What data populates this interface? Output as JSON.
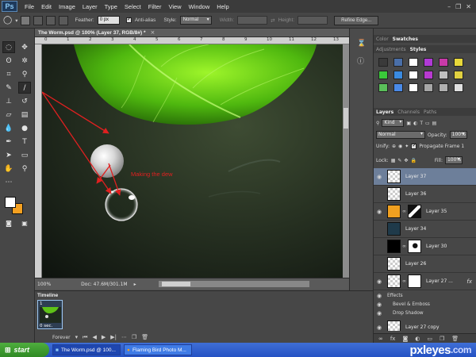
{
  "app": {
    "logo": "Ps"
  },
  "menu": [
    "File",
    "Edit",
    "Image",
    "Layer",
    "Type",
    "Select",
    "Filter",
    "View",
    "Window",
    "Help"
  ],
  "window_controls": [
    "–",
    "❐",
    "✕"
  ],
  "options_bar": {
    "feather_label": "Feather:",
    "feather_value": "0 px",
    "antialias_label": "Anti-alias",
    "style_label": "Style:",
    "style_value": "Normal",
    "width_label": "Width:",
    "height_label": "Height:",
    "refine_edge_label": "Refine Edge..."
  },
  "document": {
    "tab_title": "The Worm.psd @ 100% (Layer 37, RGB/8#) *",
    "tab_close": "×",
    "ruler_ticks": [
      "0",
      "1",
      "2",
      "3",
      "4",
      "5",
      "6",
      "7",
      "8",
      "9",
      "10",
      "11",
      "12",
      "13"
    ],
    "annotation_text": "Making the dew",
    "zoom": "100%",
    "doc_size": "Doc: 47.6M/301.1M"
  },
  "colors": {
    "foreground": "#ffffff",
    "background": "#f4a020",
    "annotation": "#e02020",
    "selected_layer": "#6d7f9a"
  },
  "timeline": {
    "tab_label": "Timeline",
    "frame_number": "1",
    "frame_delay": "0 sec.",
    "loop_value": "Forever"
  },
  "panels": {
    "top_tabs": [
      "Color",
      "Swatches"
    ],
    "style_tabs": [
      "Adjustments",
      "Styles"
    ],
    "style_swatches": [
      "#3a3a3a",
      "#4a6fa8",
      "#ffffff",
      "#b03ad6",
      "#c83aa8",
      "#e8d83a",
      "#3ac83a",
      "#3a8ae0",
      "#ffffff",
      "#b83ad0",
      "#c0c0c0",
      "#e0d040",
      "#5ac05a",
      "#4a8ae8",
      "#ffffff",
      "#a6a6a6",
      "#b0b0b0",
      "#e0e0e0"
    ],
    "layers_tabs": [
      "Layers",
      "Channels",
      "Paths"
    ],
    "filter_kind": "Kind",
    "blend_mode": "Normal",
    "opacity_label": "Opacity:",
    "opacity_value": "100%",
    "unify_label": "Unify:",
    "propagate_label": "Propagate Frame 1",
    "lock_label": "Lock:",
    "fill_label": "Fill:",
    "fill_value": "100%"
  },
  "layers": [
    {
      "name": "Layer 37",
      "thumb": "checker",
      "visible": true,
      "selected": true,
      "mask": false
    },
    {
      "name": "Layer 36",
      "thumb": "checker",
      "visible": false,
      "selected": false,
      "mask": false
    },
    {
      "name": "Layer 35",
      "thumb": "#f0a020",
      "visible": true,
      "selected": false,
      "mask": true
    },
    {
      "name": "Layer 34",
      "thumb": "#1f3a4a",
      "visible": false,
      "selected": false,
      "mask": false
    },
    {
      "name": "Layer 30",
      "thumb": "#000000",
      "visible": false,
      "selected": false,
      "mask": true
    },
    {
      "name": "Layer 26",
      "thumb": "checker",
      "visible": false,
      "selected": false,
      "mask": false
    },
    {
      "name": "Layer 27 ...",
      "thumb": "checker",
      "visible": true,
      "selected": false,
      "mask": true,
      "fx": "fx"
    },
    {
      "name": "Layer 27 copy",
      "thumb": "checker",
      "visible": true,
      "selected": false,
      "mask": false
    }
  ],
  "effects": {
    "title": "Effects",
    "items": [
      "Bevel & Emboss",
      "Drop Shadow"
    ]
  },
  "taskbar": {
    "start_label": "start",
    "tasks": [
      "The Worm.psd @ 100...",
      "Flaming Bird Photo M..."
    ],
    "watermark_main": "pxleyes",
    "watermark_tld": ".com"
  }
}
